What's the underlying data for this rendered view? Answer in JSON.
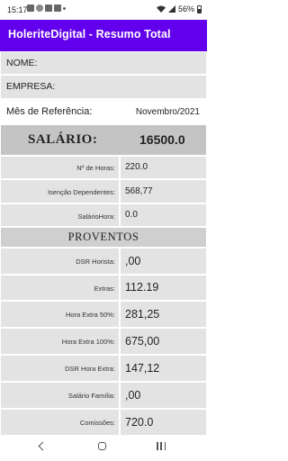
{
  "status_bar": {
    "time": "15:17",
    "battery": "56%",
    "icons": [
      "messages-icon",
      "notification-icon",
      "image-icon",
      "gallery-icon",
      "dot-icon"
    ]
  },
  "app_bar": {
    "title": "HoleriteDigital - Resumo Total",
    "color": "#6200ee"
  },
  "fields": {
    "nome_label": "NOME:",
    "empresa_label": "EMPRESA:",
    "mes_label": "Mês de Referência:",
    "mes_value": "Novembro/2021"
  },
  "salario": {
    "label": "SALÁRIO:",
    "value": "16500.0"
  },
  "info": [
    {
      "label": "Nº de Horas:",
      "value": "220.0"
    },
    {
      "label": "Isenção Dependentes:",
      "value": "568,77"
    },
    {
      "label": "SalárioHora:",
      "value": "0.0"
    }
  ],
  "proventos": {
    "title": "PROVENTOS",
    "items": [
      {
        "label": "DSR Horista:",
        "value": ",00"
      },
      {
        "label": "Extras:",
        "value": "112.19"
      },
      {
        "label": "Hora Extra 50%:",
        "value": "281,25"
      },
      {
        "label": "Hora Extra 100%:",
        "value": "675,00"
      },
      {
        "label": "DSR Hora Extra:",
        "value": "147,12"
      },
      {
        "label": "Salário Família:",
        "value": ",00"
      },
      {
        "label": "Comissões:",
        "value": "720.0"
      }
    ]
  }
}
